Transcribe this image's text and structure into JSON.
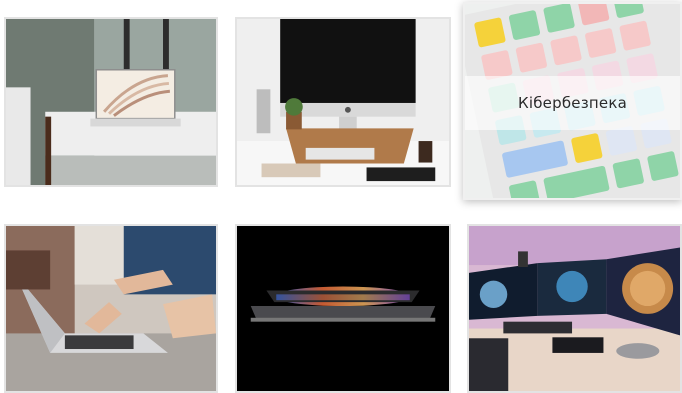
{
  "gallery": {
    "tiles": [
      {
        "id": "t1",
        "icon": "laptop-on-bench-photo"
      },
      {
        "id": "t2",
        "icon": "imac-desk-photo"
      },
      {
        "id": "t3",
        "icon": "pastel-keyboard-photo",
        "label": "Кібербезпека",
        "hovered": true
      },
      {
        "id": "t4",
        "icon": "team-laptop-photo"
      },
      {
        "id": "t5",
        "icon": "glowing-laptop-photo"
      },
      {
        "id": "t6",
        "icon": "gaming-setup-photo"
      }
    ]
  },
  "colors": {
    "tile_border": "#e3e3e3",
    "overlay_bg": "#ffffff",
    "label_text": "#2b2b2b"
  }
}
